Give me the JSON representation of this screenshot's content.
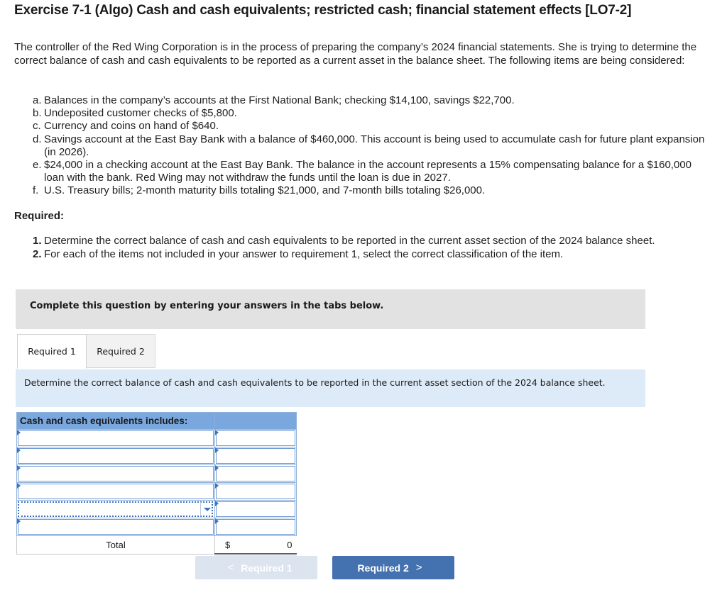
{
  "title": "Exercise 7-1 (Algo) Cash and cash equivalents; restricted cash; financial statement effects [LO7-2]",
  "intro": "The controller of the Red Wing Corporation is in the process of preparing the company’s 2024 financial statements. She is trying to determine the correct balance of cash and cash equivalents to be reported as a current asset in the balance sheet. The following items are being considered:",
  "items": [
    {
      "label": "a.",
      "text": "Balances in the company’s accounts at the First National Bank; checking $14,100, savings $22,700."
    },
    {
      "label": "b.",
      "text": "Undeposited customer checks of $5,800."
    },
    {
      "label": "c.",
      "text": "Currency and coins on hand of $640."
    },
    {
      "label": "d.",
      "text": "Savings account at the East Bay Bank with a balance of $460,000. This account is being used to accumulate cash for future plant expansion (in 2026)."
    },
    {
      "label": "e.",
      "text": "$24,000 in a checking account at the East Bay Bank. The balance in the account represents a 15% compensating balance for a $160,000 loan with the bank. Red Wing may not withdraw the funds until the loan is due in 2027."
    },
    {
      "label": "f.",
      "text": "U.S. Treasury bills; 2-month maturity bills totaling $21,000, and 7-month bills totaling $26,000."
    }
  ],
  "required_heading": "Required:",
  "requirements": [
    {
      "num": "1.",
      "text": "Determine the correct balance of cash and cash equivalents to be reported in the current asset section of the 2024 balance sheet."
    },
    {
      "num": "2.",
      "text": "For each of the items not included in your answer to requirement 1, select the correct classification of the item."
    }
  ],
  "banner": "Complete this question by entering your answers in the tabs below.",
  "tabs": [
    {
      "label": "Required 1",
      "active": true
    },
    {
      "label": "Required 2",
      "active": false
    }
  ],
  "instruction": "Determine the correct balance of cash and cash equivalents to be reported in the current asset section of the 2024 balance sheet.",
  "table": {
    "header": "Cash and cash equivalents includes:",
    "rows": [
      {
        "description": "",
        "amount": ""
      },
      {
        "description": "",
        "amount": ""
      },
      {
        "description": "",
        "amount": ""
      },
      {
        "description": "",
        "amount": ""
      },
      {
        "description": "",
        "amount": ""
      },
      {
        "description": "",
        "amount": ""
      }
    ],
    "total_label": "Total",
    "total_currency": "$",
    "total_value": "0"
  },
  "nav": {
    "prev_label": "Required 1",
    "next_label": "Required 2",
    "prev_chevron": "<",
    "next_chevron": ">"
  }
}
